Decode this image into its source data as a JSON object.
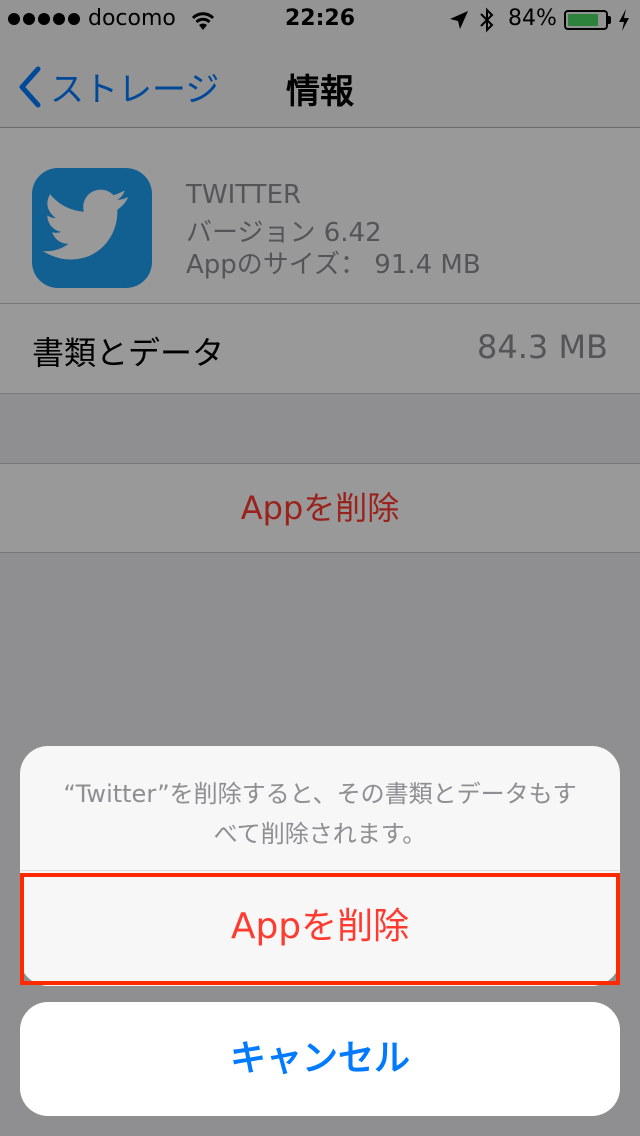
{
  "status_bar": {
    "carrier": "docomo",
    "time": "22:26",
    "battery_percent": "84%",
    "battery_level": 0.84,
    "icons": [
      "signal-dots-icon",
      "wifi-icon",
      "location-arrow-icon",
      "bluetooth-icon",
      "battery-icon",
      "charging-bolt-icon"
    ]
  },
  "nav": {
    "back_label": "ストレージ",
    "title": "情報"
  },
  "app": {
    "name": "TWITTER",
    "version": "バージョン 6.42",
    "size": "Appのサイズ： 91.4 MB",
    "icon": "twitter-bird-icon",
    "icon_color": "#1da1f2"
  },
  "documents": {
    "label": "書類とデータ",
    "value": "84.3 MB"
  },
  "delete_row": {
    "label": "Appを削除"
  },
  "action_sheet": {
    "message": "“Twitter”を削除すると、その書類とデータもすべて削除されます。",
    "destructive_label": "Appを削除",
    "cancel_label": "キャンセル",
    "highlight_color": "#ff2a00"
  },
  "colors": {
    "destructive": "#ff3b30",
    "accent": "#007aff"
  }
}
